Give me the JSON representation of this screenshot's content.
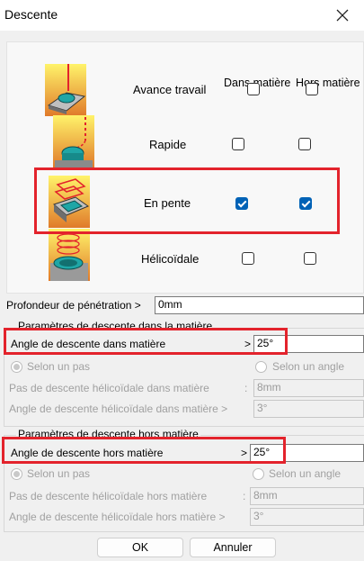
{
  "window": {
    "title": "Descente"
  },
  "headers": {
    "dans": "Dans matière",
    "hors": "Hors matière"
  },
  "rows": [
    {
      "label": "Avance travail",
      "dans": false,
      "hors": false
    },
    {
      "label": "Rapide",
      "dans": false,
      "hors": false
    },
    {
      "label": "En pente",
      "dans": true,
      "hors": true
    },
    {
      "label": "Hélicoïdale",
      "dans": false,
      "hors": false
    }
  ],
  "profondeur": {
    "label": "Profondeur de pénétration >",
    "value": "0mm"
  },
  "dans_group": {
    "legend": "Paramètres de descente dans la matière",
    "angle_label": "Angle de descente dans matière",
    "angle_arrow": ">",
    "angle_value": "25°",
    "radio_pas": "Selon un pas",
    "radio_angle": "Selon un angle",
    "pas_label": "Pas de descente hélicoïdale dans matière",
    "pas_sep": ":",
    "pas_value": "8mm",
    "ang_label": "Angle de descente hélicoïdale dans matière >",
    "ang_value": "3°"
  },
  "hors_group": {
    "legend": "Paramètres de descente hors matière",
    "angle_label": "Angle de descente hors matière",
    "angle_arrow": ">",
    "angle_value": "25°",
    "radio_pas": "Selon un pas",
    "radio_angle": "Selon un angle",
    "pas_label": "Pas de descente hélicoïdale hors matière",
    "pas_sep": ":",
    "pas_value": "8mm",
    "ang_label": "Angle de descente hélicoïdale hors matière >",
    "ang_value": "3°"
  },
  "buttons": {
    "ok": "OK",
    "cancel": "Annuler"
  },
  "colors": {
    "highlight": "#e3232c",
    "checkbox": "#0062b6"
  }
}
